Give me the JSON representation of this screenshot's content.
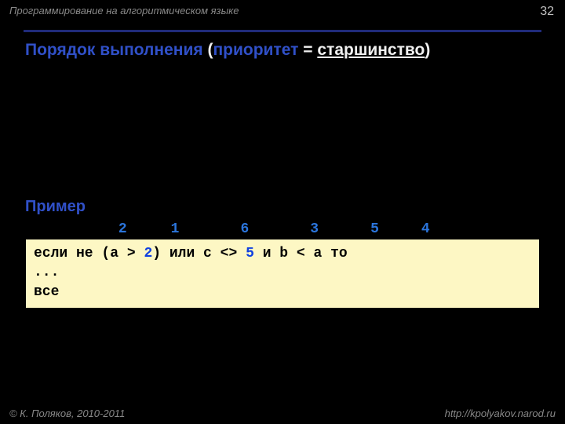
{
  "header": {
    "label": "Программирование на алгоритмическом языке",
    "page": "32"
  },
  "title": {
    "prefix": "Порядок выполнения ",
    "paren_open": "(",
    "priority": "приоритет",
    "eq": " = ",
    "stars": "старшинство",
    "paren_close": ")"
  },
  "section": "Пример",
  "nums": {
    "n1": "2",
    "n2": "1",
    "n3": "6",
    "n4": "3",
    "n5": "5",
    "n6": "4"
  },
  "code": {
    "p1": "если не (a > ",
    "lit1": "2",
    "p2": ") или c <> ",
    "lit2": "5",
    "p3": " и b < a то",
    "l2": "...",
    "l3": "все"
  },
  "footer": {
    "left": "© К. Поляков, 2010-2011",
    "right": "http://kpolyakov.narod.ru"
  }
}
